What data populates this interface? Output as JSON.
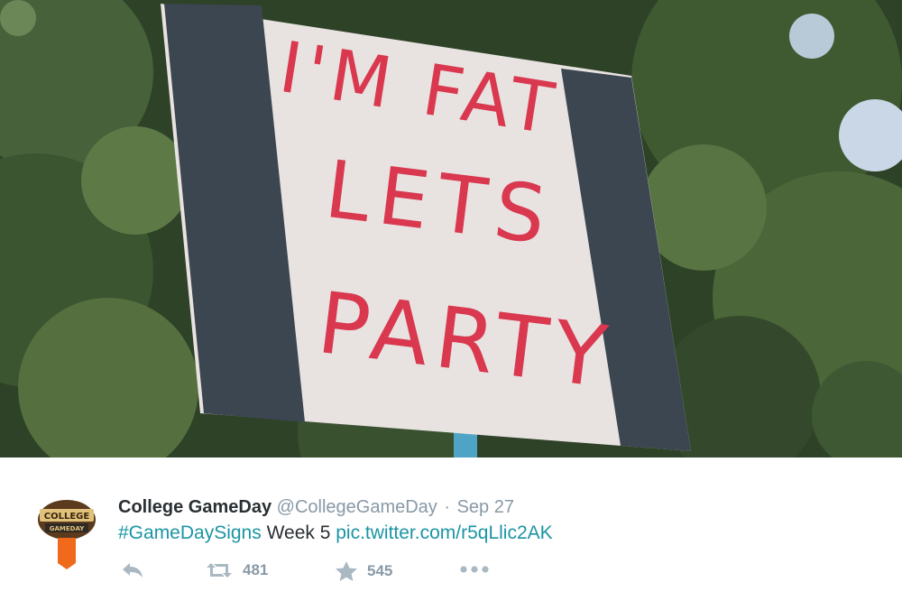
{
  "photo": {
    "sign_lines": [
      "I'M FAT",
      "LETS",
      "PARTY"
    ],
    "sign_text_color": "#d9384f",
    "sign_board_color": "#ece7e5",
    "tape_color": "#3b4650",
    "pole_color": "#4fa3c4"
  },
  "tweet": {
    "avatar_icon": "college-gameday-logo-icon",
    "author_name": "College GameDay",
    "author_handle": "@CollegeGameDay",
    "separator": "·",
    "timestamp": "Sep 27",
    "hashtag": "#GameDaySigns",
    "body_text": " Week 5 ",
    "link_text": "pic.twitter.com/r5qLlic2AK",
    "link_color": "#1b95a4",
    "actions": {
      "reply_icon": "reply-icon",
      "retweet_icon": "retweet-icon",
      "retweet_count": "481",
      "favorite_icon": "star-icon",
      "favorite_count": "545",
      "more_icon": "more-dots-icon"
    }
  }
}
